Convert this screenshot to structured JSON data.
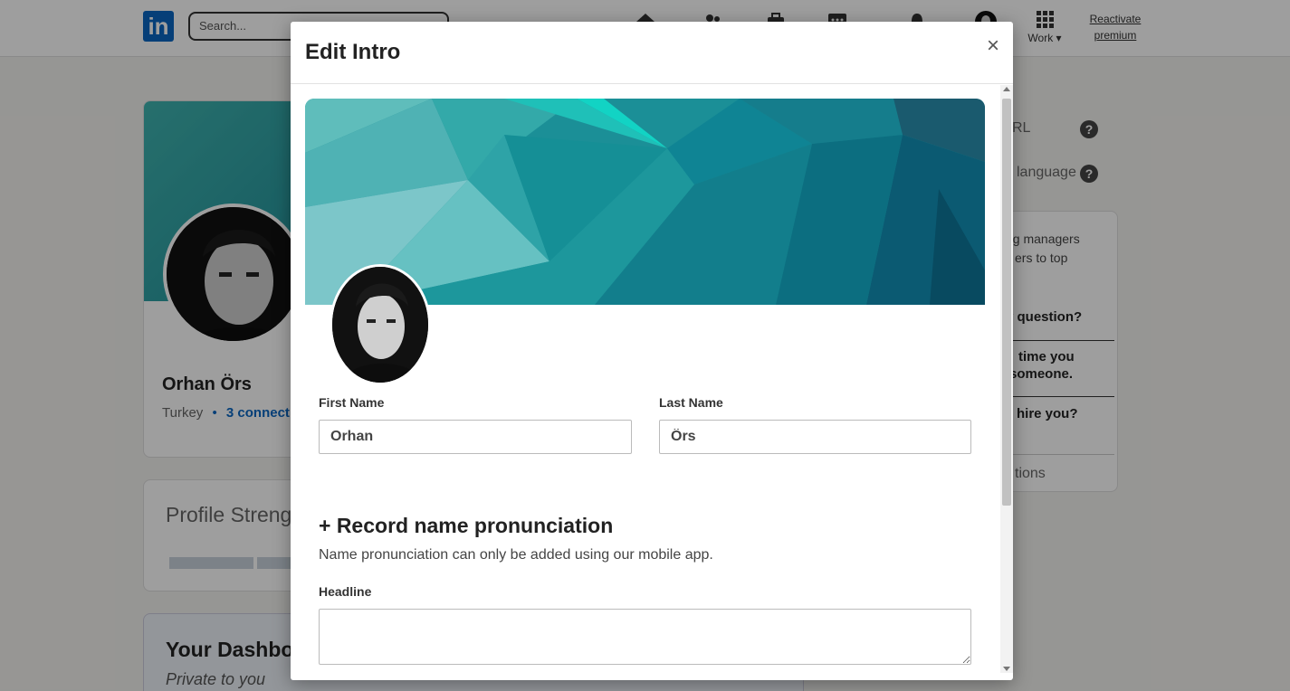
{
  "topbar": {
    "search_placeholder": "Search...",
    "work_label": "Work",
    "reactivate_line1": "Reactivate",
    "reactivate_line2": "premium"
  },
  "profile": {
    "name": "Orhan Örs",
    "location": "Turkey",
    "separator": "•",
    "connections": "3 connect"
  },
  "strength": {
    "title": "Profile Streng"
  },
  "dashboard": {
    "title": "Your Dashbo",
    "subtitle": "Private to you"
  },
  "right_panel": {
    "url_label": "RL",
    "language_label": "language",
    "help_glyph": "?",
    "hire_text_1": "ng managers",
    "hire_text_2": "ers   to   top",
    "question_1": "y question?",
    "question_2a": "time you",
    "question_2b": "someone.",
    "question_3": "hire you?",
    "footer": "tions"
  },
  "modal": {
    "title": "Edit Intro",
    "close_glyph": "×",
    "first_name_label": "First Name",
    "first_name_value": "Orhan",
    "last_name_label": "Last Name",
    "last_name_value": "Örs",
    "record_label": "+ Record name pronunciation",
    "pronunciation_note": "Name pronunciation can only be added using our mobile app.",
    "headline_label": "Headline",
    "headline_value": ""
  },
  "colors": {
    "brand": "#0a66c2",
    "banner_light": "#6cc7c8",
    "banner_dark": "#0b5a72"
  }
}
